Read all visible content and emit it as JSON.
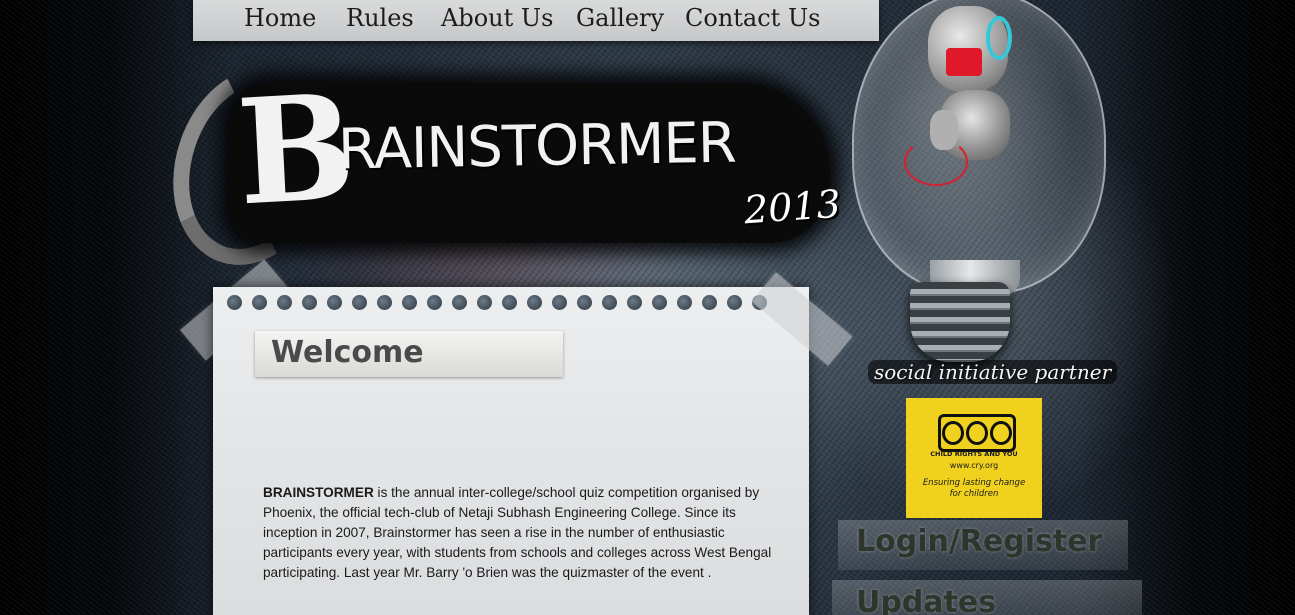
{
  "nav": {
    "items": [
      {
        "label": "Home"
      },
      {
        "label": "Rules"
      },
      {
        "label": "About Us"
      },
      {
        "label": "Gallery"
      },
      {
        "label": "Contact Us"
      }
    ]
  },
  "logo": {
    "first_letter": "B",
    "rest": "RAINSTORMER",
    "year": "2013"
  },
  "welcome": {
    "heading": "Welcome",
    "event_name": "BRAINSTORMER",
    "body": " is the annual inter-college/school quiz competition organised by Phoenix, the official tech-club of Netaji Subhash Engineering College. Since its inception in 2007, Brainstormer has seen a rise in the number of enthusiastic participants every year, with students from schools and colleges across West Bengal participating. Last year Mr. Barry 'o Brien was the quizmaster of the event ."
  },
  "sidebar": {
    "partner_label": "social initiative partner",
    "partner": {
      "name_line": "CHILD RIGHTS AND YOU",
      "url": "www.cry.org",
      "tagline_1": "Ensuring lasting change",
      "tagline_2": "for children"
    },
    "login_label": "Login/Register",
    "updates_label": "Updates"
  },
  "colors": {
    "nav_bg": "#d9dadb",
    "paper_bg": "#e6e8ea",
    "partner_yellow": "#f0d21e",
    "heading_dark": "#2e352c"
  }
}
